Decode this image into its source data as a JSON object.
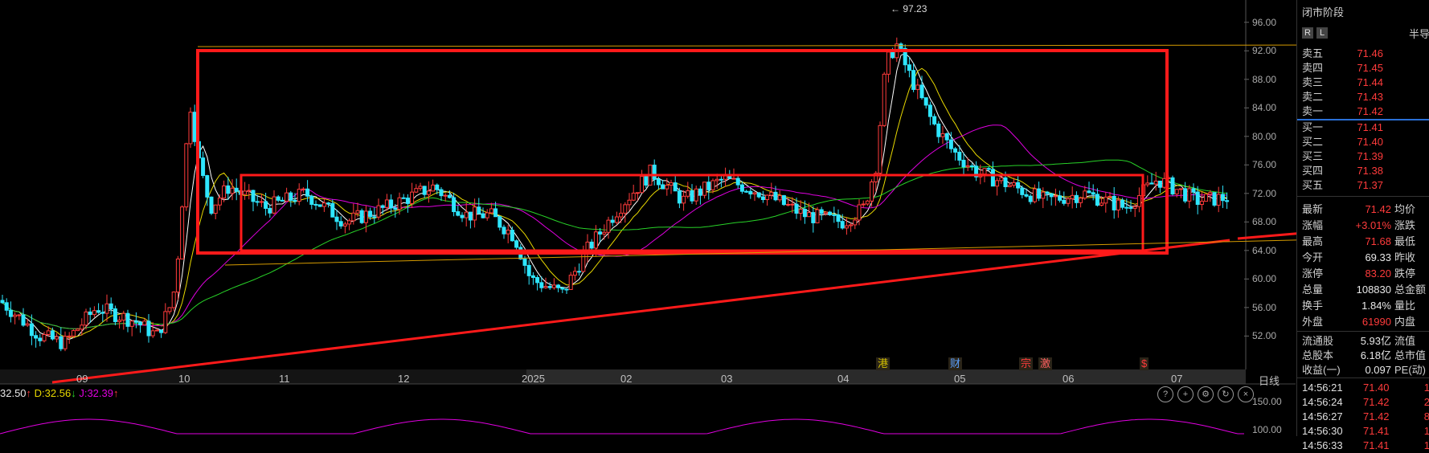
{
  "chart_data": {
    "type": "candlestick",
    "price_axis_ticks": [
      "96.00",
      "92.00",
      "88.00",
      "84.00",
      "80.00",
      "76.00",
      "72.00",
      "68.00",
      "64.00",
      "60.00",
      "56.00",
      "52.00"
    ],
    "ylim": [
      49,
      98
    ],
    "x_ticks": [
      "09",
      "10",
      "11",
      "12",
      "2025",
      "02",
      "03",
      "04",
      "05",
      "06",
      "07"
    ],
    "x_end_label": "日线",
    "high_annotation": "97.23",
    "event_tags": [
      {
        "label": "港",
        "color": "#d4c000"
      },
      {
        "label": "财",
        "color": "#5aa0ff"
      },
      {
        "label": "宗",
        "color": "#ff3b3b"
      },
      {
        "label": "激",
        "color": "#ff6060"
      },
      {
        "label": "$",
        "color": "#ff3b3b"
      }
    ],
    "sub_axis_ticks": [
      "150.00",
      "100.00"
    ],
    "kdj": {
      "k": "32.50",
      "k_arrow": "↑",
      "d": "D:32.56",
      "d_arrow": "↓",
      "j": "J:32.39",
      "j_arrow": "↑"
    },
    "up_color": "#ff3b3b",
    "down_color": "#2ee6ff",
    "ma_colors": [
      "#ffffff",
      "#e8d800",
      "#e000e0",
      "#28d228"
    ]
  },
  "panel": {
    "title": "闭市阶段",
    "rl": [
      "R",
      "L"
    ],
    "right_label": "半导",
    "sells": [
      {
        "label": "卖五",
        "price": "71.46"
      },
      {
        "label": "卖四",
        "price": "71.45"
      },
      {
        "label": "卖三",
        "price": "71.44"
      },
      {
        "label": "卖二",
        "price": "71.43"
      },
      {
        "label": "卖一",
        "price": "71.42"
      }
    ],
    "buys": [
      {
        "label": "买一",
        "price": "71.41"
      },
      {
        "label": "买二",
        "price": "71.40"
      },
      {
        "label": "买三",
        "price": "71.39"
      },
      {
        "label": "买四",
        "price": "71.38"
      },
      {
        "label": "买五",
        "price": "71.37"
      }
    ],
    "stats": [
      {
        "label": "最新",
        "value": "71.42",
        "color": "red",
        "label2": "均价"
      },
      {
        "label": "涨幅",
        "value": "+3.01%",
        "color": "red",
        "label2": "涨跌"
      },
      {
        "label": "最高",
        "value": "71.68",
        "color": "red",
        "label2": "最低"
      },
      {
        "label": "今开",
        "value": "69.33",
        "color": "white",
        "label2": "昨收"
      },
      {
        "label": "涨停",
        "value": "83.20",
        "color": "red",
        "label2": "跌停"
      },
      {
        "label": "总量",
        "value": "108830",
        "color": "white",
        "label2": "总金额"
      },
      {
        "label": "换手",
        "value": "1.84%",
        "color": "white",
        "label2": "量比"
      },
      {
        "label": "外盘",
        "value": "61990",
        "color": "red",
        "label2": "内盘"
      }
    ],
    "fundamentals": [
      {
        "label": "流通股",
        "value": "5.93亿",
        "label2": "流值"
      },
      {
        "label": "总股本",
        "value": "6.18亿",
        "label2": "总市值"
      },
      {
        "label": "收益(一)",
        "value": "0.097",
        "label2": "PE(动)"
      }
    ],
    "ticks": [
      {
        "time": "14:56:21",
        "price": "71.40",
        "vol": "1"
      },
      {
        "time": "14:56:24",
        "price": "71.42",
        "vol": "2"
      },
      {
        "time": "14:56:27",
        "price": "71.42",
        "vol": "8"
      },
      {
        "time": "14:56:30",
        "price": "71.41",
        "vol": "1"
      },
      {
        "time": "14:56:33",
        "price": "71.41",
        "vol": "1"
      }
    ]
  }
}
